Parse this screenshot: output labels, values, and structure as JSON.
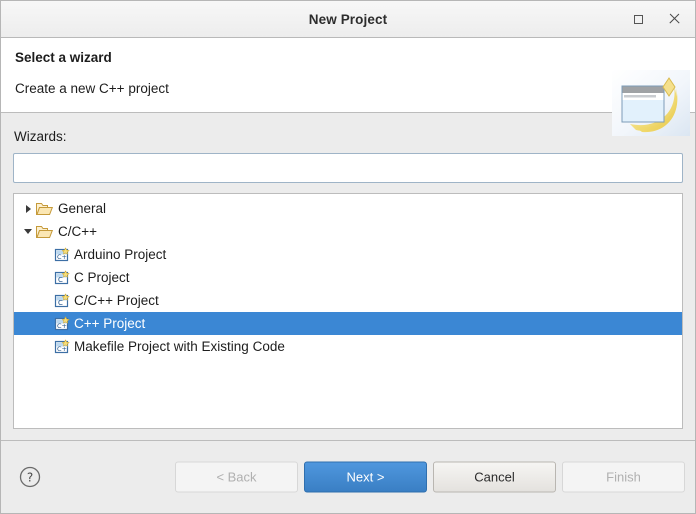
{
  "window": {
    "title": "New Project",
    "controls": [
      {
        "name": "maximize",
        "icon": "maximize-icon"
      },
      {
        "name": "close",
        "icon": "close-icon"
      }
    ]
  },
  "header": {
    "title": "Select a wizard",
    "description": "Create a new C++ project",
    "icon": "new-project-wizard-icon"
  },
  "form": {
    "wizards_label": "Wizards:",
    "filter_value": "",
    "filter_placeholder": ""
  },
  "tree": {
    "rows": [
      {
        "label": "General",
        "type": "folder",
        "level": 0,
        "twisty": "collapsed",
        "icon": "folder-icon",
        "selected": false
      },
      {
        "label": "C/C++",
        "type": "folder",
        "level": 0,
        "twisty": "expanded",
        "icon": "folder-icon",
        "selected": false
      },
      {
        "label": "Arduino Project",
        "type": "wizard",
        "level": 1,
        "twisty": "none",
        "icon": "cpp-project-icon",
        "selected": false
      },
      {
        "label": "C Project",
        "type": "wizard",
        "level": 1,
        "twisty": "none",
        "icon": "c-project-icon",
        "selected": false
      },
      {
        "label": "C/C++ Project",
        "type": "wizard",
        "level": 1,
        "twisty": "none",
        "icon": "c-project-icon",
        "selected": false
      },
      {
        "label": "C++ Project",
        "type": "wizard",
        "level": 1,
        "twisty": "none",
        "icon": "cpp-project-icon",
        "selected": true
      },
      {
        "label": "Makefile Project with Existing Code",
        "type": "wizard",
        "level": 1,
        "twisty": "none",
        "icon": "cpp-project-icon",
        "selected": false
      }
    ]
  },
  "footer": {
    "help_icon": "help-icon",
    "buttons": [
      {
        "label": "< Back",
        "state": "disabled"
      },
      {
        "label": "Next >",
        "state": "primary"
      },
      {
        "label": "Cancel",
        "state": "normal"
      },
      {
        "label": "Finish",
        "state": "disabled"
      }
    ]
  },
  "colors": {
    "selection": "#3b87d4",
    "primary_button": "#3a7fc4",
    "window_background": "#ececec",
    "panel_background": "#ffffff"
  }
}
